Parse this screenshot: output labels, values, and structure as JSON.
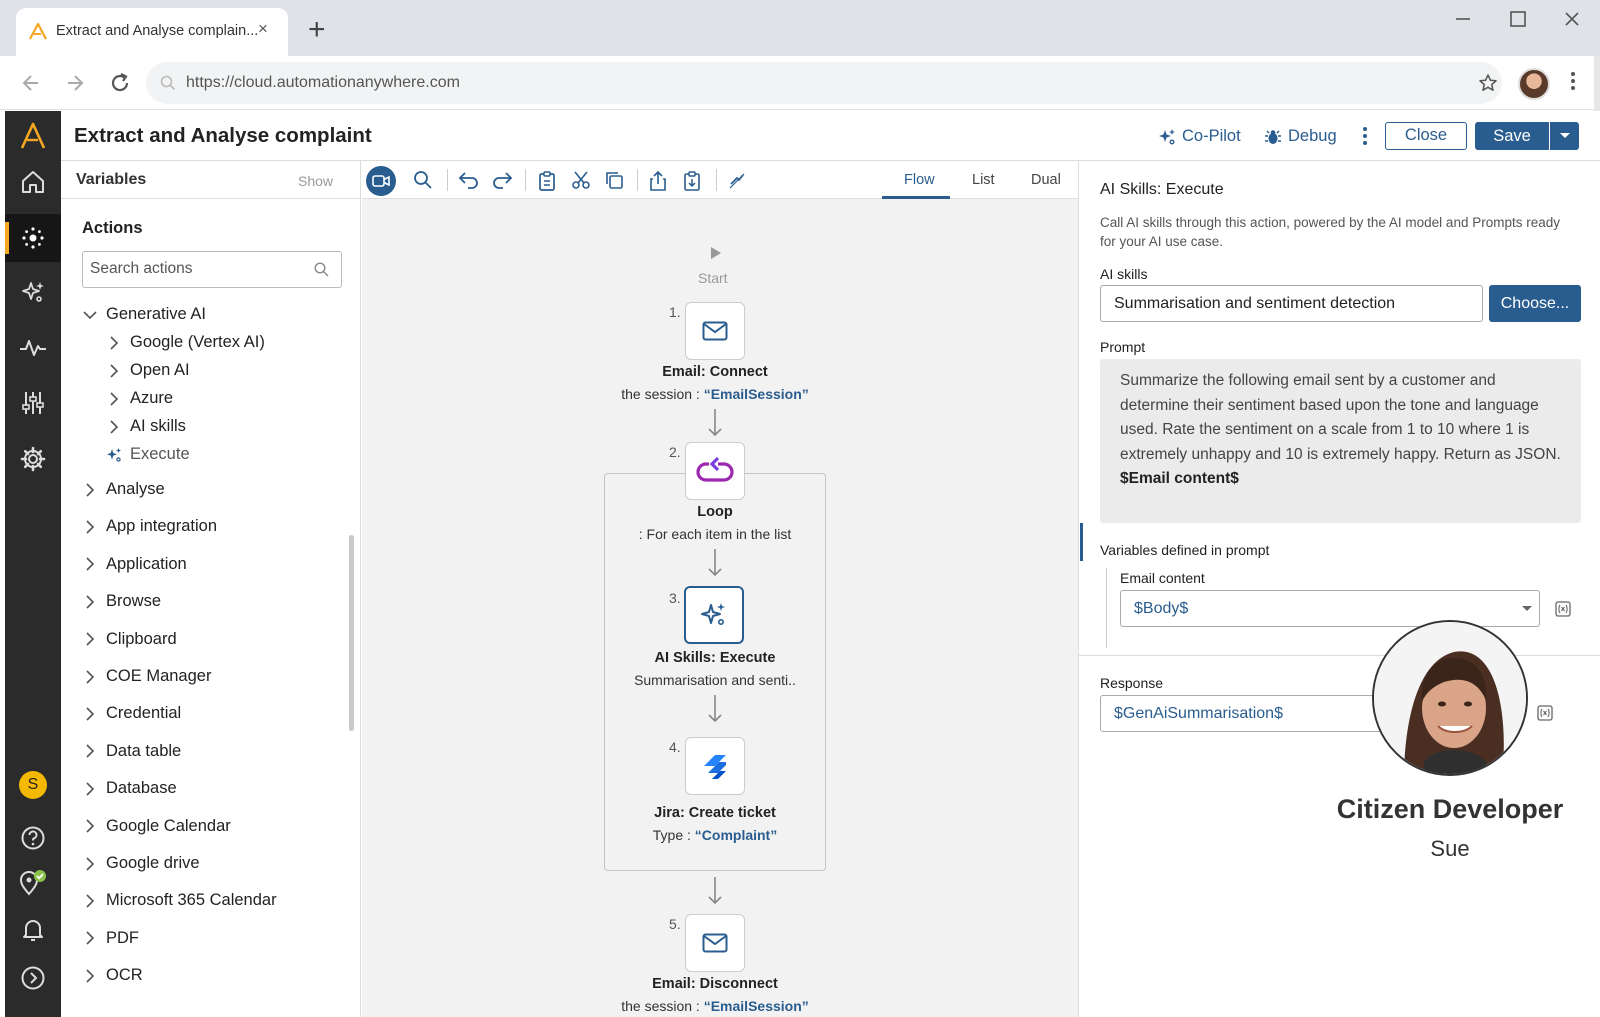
{
  "browser": {
    "tab_title": "Extract and Analyse complain...",
    "tab_close": "×",
    "new_tab": "+",
    "url": "https://cloud.automationanywhere.com"
  },
  "rail": {
    "icons": [
      "logo-icon",
      "home-icon",
      "bots-icon",
      "ai-sparkle-icon",
      "pulse-icon",
      "sliders-icon",
      "gear-icon",
      "help-icon",
      "location-check-icon",
      "bell-icon",
      "expand-icon"
    ],
    "avatar_initial": "S",
    "accent_color": "#f5a623"
  },
  "header": {
    "title": "Extract and Analyse complaint",
    "copilot_label": "Co-Pilot",
    "debug_label": "Debug",
    "close_label": "Close",
    "save_label": "Save",
    "primary_color": "#2a5d8f"
  },
  "left_panel": {
    "variables_label": "Variables",
    "show_label": "Show",
    "actions_label": "Actions",
    "search_placeholder": "Search actions",
    "tree": {
      "generative_ai": "Generative AI",
      "google_vertex": "Google (Vertex AI)",
      "open_ai": "Open AI",
      "azure": "Azure",
      "ai_skills": "AI skills",
      "execute": "Execute",
      "groups": [
        "Analyse",
        "App integration",
        "Application",
        "Browse",
        "Clipboard",
        "COE Manager",
        "Credential",
        "Data table",
        "Database",
        "Google Calendar",
        "Google drive",
        "Microsoft 365 Calendar",
        "PDF",
        "OCR"
      ]
    }
  },
  "toolbar": {
    "view_tabs": [
      "Flow",
      "List",
      "Dual"
    ],
    "active_view": "Flow"
  },
  "flow": {
    "start_label": "Start",
    "steps": [
      {
        "num": "1.",
        "title": "Email: Connect",
        "desc_prefix": "the session : ",
        "desc_value": "“EmailSession”",
        "icon": "envelope-icon"
      },
      {
        "num": "2.",
        "title": "Loop",
        "desc_prefix": ": For each item in the list",
        "desc_value": "",
        "icon": "loop-icon"
      },
      {
        "num": "3.",
        "title": "AI Skills: Execute",
        "desc_prefix": "Summarisation and senti..",
        "desc_value": "",
        "icon": "ai-sparkle-icon"
      },
      {
        "num": "4.",
        "title": "Jira: Create ticket",
        "desc_prefix": "Type : ",
        "desc_value": "“Complaint”",
        "icon": "jira-icon"
      },
      {
        "num": "5.",
        "title": "Email: Disconnect",
        "desc_prefix": "the session : ",
        "desc_value": "“EmailSession”",
        "icon": "envelope-icon"
      }
    ]
  },
  "right_panel": {
    "title": "AI Skills: Execute",
    "description": "Call AI skills through this action, powered by the AI model and Prompts ready for your AI use case.",
    "ai_skills_label": "AI skills",
    "ai_skills_value": "Summarisation and sentiment detection",
    "choose_label": "Choose...",
    "prompt_label": "Prompt",
    "prompt_text": "Summarize the following email sent by a customer and determine their sentiment based upon the tone and language used. Rate the sentiment on a scale from 1 to 10 where 1 is extremely unhappy and 10 is extremely happy. Return as JSON.",
    "prompt_variable": "$Email content$",
    "vars_defined_label": "Variables defined in prompt",
    "email_content_label": "Email content",
    "email_content_value": "$Body$",
    "response_label": "Response",
    "response_value": "$GenAiSummarisation$"
  },
  "persona": {
    "name": "Citizen Developer",
    "sub": "Sue"
  }
}
